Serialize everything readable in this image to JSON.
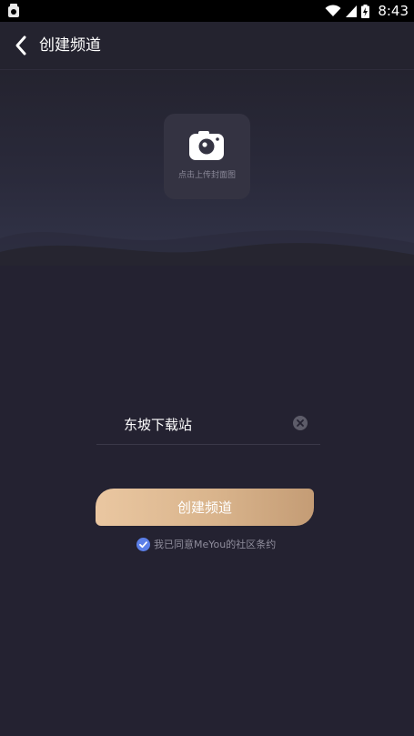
{
  "status_bar": {
    "time": "8:43"
  },
  "header": {
    "title": "创建频道"
  },
  "cover": {
    "label": "点击上传封面图"
  },
  "channel_name": {
    "value": "东坡下载站"
  },
  "create_button": {
    "label": "创建频道"
  },
  "agreement": {
    "checked": true,
    "text": "我已同意MeYou的社区条约"
  },
  "colors": {
    "background": "#242231",
    "button_gradient_start": "#eac7a1",
    "button_gradient_end": "#c49c75",
    "checkbox": "#5b7fe8"
  }
}
